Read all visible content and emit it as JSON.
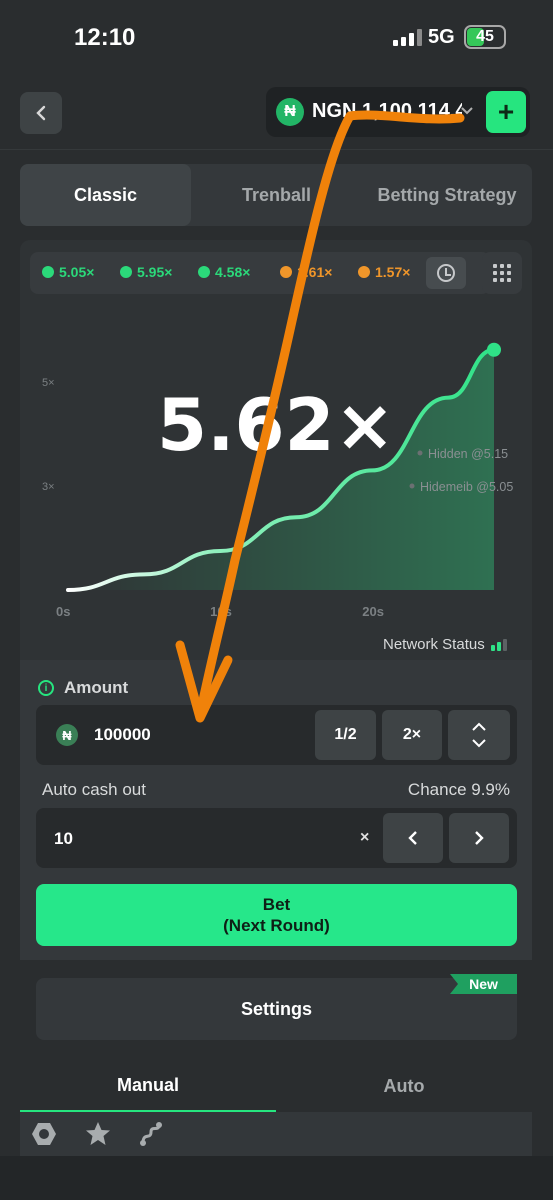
{
  "status_bar": {
    "time": "12:10",
    "network": "5G",
    "battery": "45",
    "battery_level": 0.45
  },
  "header": {
    "back_icon": "chevron-left-icon",
    "currency_icon": "₦",
    "currency_text": "NGN 1,100,114.4",
    "chevron_icon": "chevron-down-icon",
    "add_icon": "plus-icon",
    "add_label": "+"
  },
  "game_tabs": [
    {
      "label": "Classic",
      "active": true
    },
    {
      "label": "Trenball",
      "active": false
    },
    {
      "label": "Betting Strategy",
      "active": false
    }
  ],
  "history": [
    {
      "value": "5.05×",
      "color": "#2bd97a"
    },
    {
      "value": "5.95×",
      "color": "#2bd97a"
    },
    {
      "value": "4.58×",
      "color": "#2bd97a"
    },
    {
      "value": "1.61×",
      "color": "#f0962a"
    },
    {
      "value": "1.57×",
      "color": "#f0962a"
    }
  ],
  "chart": {
    "multiplier": "5.62×",
    "y_ticks": [
      "5×",
      "3×"
    ],
    "x_ticks": [
      "0s",
      "10s",
      "20s"
    ],
    "players": [
      "Hidden @5.15",
      "Hidemeib @5.05"
    ],
    "network_status": "Network Status",
    "accent_color": "#2fe287"
  },
  "chart_data": {
    "type": "line",
    "title": "",
    "xlabel": "",
    "ylabel": "",
    "x": [
      0,
      5,
      10,
      15,
      20,
      25,
      28
    ],
    "series": [
      {
        "values": [
          1.0,
          1.3,
          1.75,
          2.4,
          3.3,
          4.7,
          5.62
        ]
      }
    ],
    "xlim": [
      0,
      28
    ],
    "ylim": [
      1,
      6
    ]
  },
  "bet": {
    "amount_label": "Amount",
    "amount_icon": "₦",
    "amount_value": "100000",
    "half_label": "1/2",
    "double_label": "2×",
    "stepper_up": "⌃",
    "stepper_down": "⌄",
    "auto_cashout_label": "Auto cash out",
    "chance_label": "Chance 9.9%",
    "cashout_value": "10",
    "cashout_suffix": "×",
    "prev_label": "‹",
    "next_label": "›",
    "bet_label": "Bet",
    "bet_sublabel": "(Next Round)"
  },
  "settings": {
    "label": "Settings",
    "badge": "New"
  },
  "mode_tabs": [
    {
      "label": "Manual",
      "active": true
    },
    {
      "label": "Auto",
      "active": false
    }
  ],
  "bottom_icons": [
    "hexagon-nut-icon",
    "star-icon",
    "route-icon"
  ],
  "colors": {
    "brand": "#26e57f",
    "background": "#2a2d2f",
    "annotation": "#f0820a"
  }
}
